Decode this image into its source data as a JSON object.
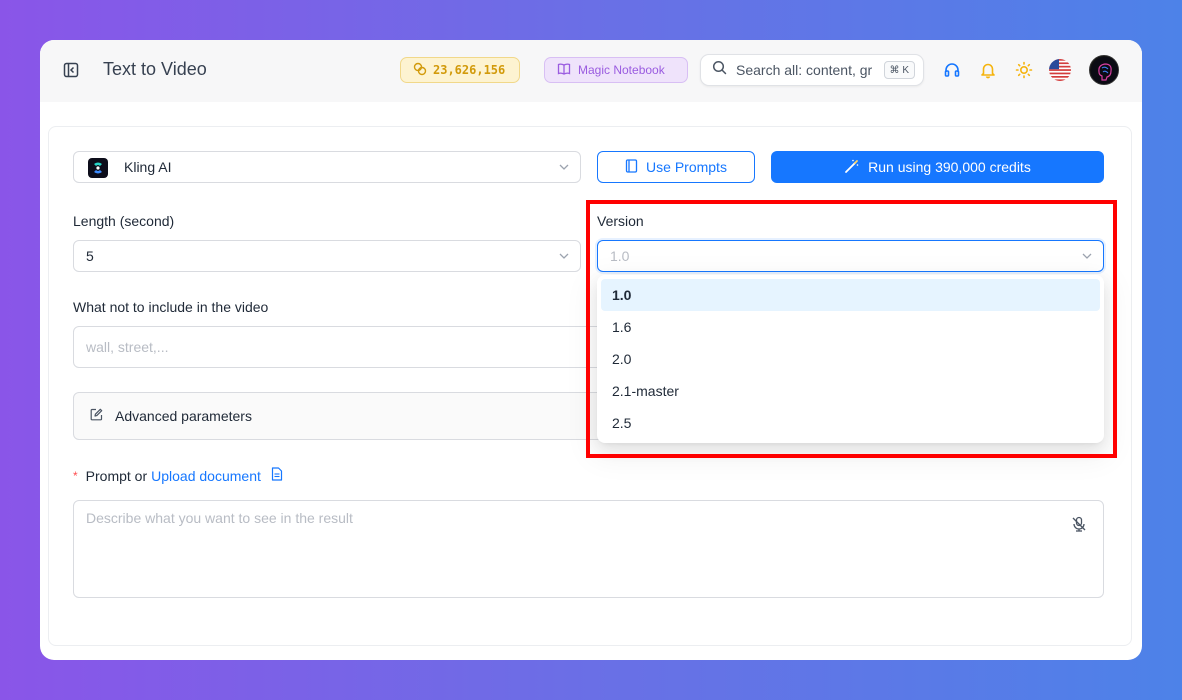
{
  "header": {
    "title": "Text to Video",
    "credits": "23,626,156",
    "magic_notebook_label": "Magic Notebook",
    "search_placeholder": "Search all: content, gr",
    "search_shortcut": "⌘ K"
  },
  "form": {
    "model_name": "Kling AI",
    "use_prompts_label": "Use Prompts",
    "run_label": "Run using 390,000 credits",
    "length_label": "Length (second)",
    "length_value": "5",
    "version_label": "Version",
    "version_value": "1.0",
    "negative_label": "What not to include in the video",
    "negative_placeholder": "wall, street,...",
    "advanced_label": "Advanced parameters",
    "prompt_required_mark": "*",
    "prompt_label": "Prompt or",
    "upload_link": "Upload document",
    "prompt_placeholder": "Describe what you want to see in the result"
  },
  "version_dropdown": {
    "options": [
      "1.0",
      "1.6",
      "2.0",
      "2.1-master",
      "2.5"
    ],
    "selected": "1.0"
  },
  "colors": {
    "primary": "#1677ff",
    "highlight": "#ff0000",
    "credits_text": "#d29a0b",
    "magic_text": "#9a5be0"
  }
}
